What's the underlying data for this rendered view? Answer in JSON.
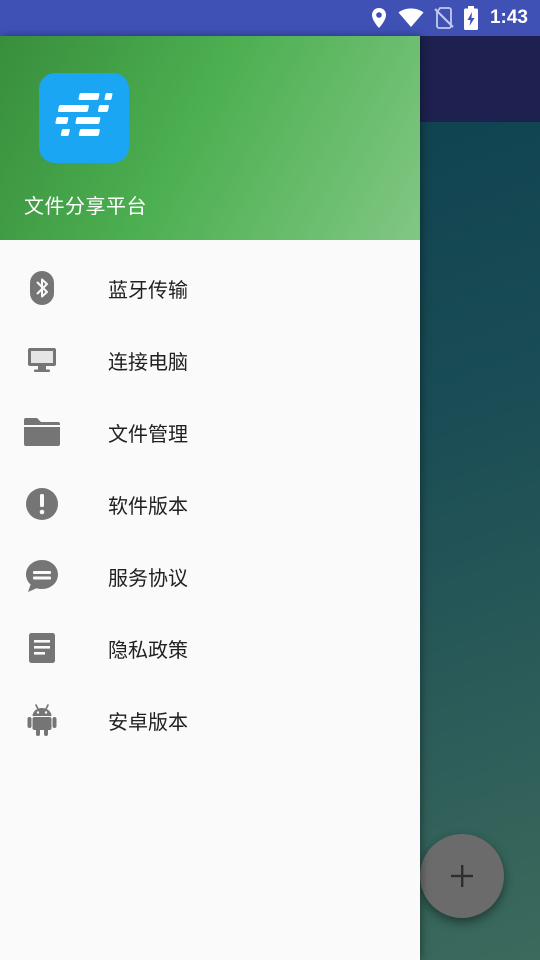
{
  "status_bar": {
    "time": "1:43",
    "background": "#3f51b5",
    "icons": [
      "location-icon",
      "wifi-icon",
      "no-sim-icon",
      "battery-charging-icon"
    ]
  },
  "drawer": {
    "app_name": "文件分享平台",
    "header_color": "#4caf50",
    "menu": [
      {
        "label": "蓝牙传输",
        "icon": "bluetooth-icon"
      },
      {
        "label": "连接电脑",
        "icon": "computer-icon"
      },
      {
        "label": "文件管理",
        "icon": "folder-icon"
      },
      {
        "label": "软件版本",
        "icon": "info-icon"
      },
      {
        "label": "服务协议",
        "icon": "chat-bubble-icon"
      },
      {
        "label": "隐私政策",
        "icon": "document-icon"
      },
      {
        "label": "安卓版本",
        "icon": "android-icon"
      }
    ]
  },
  "fab": {
    "icon": "plus-icon"
  }
}
